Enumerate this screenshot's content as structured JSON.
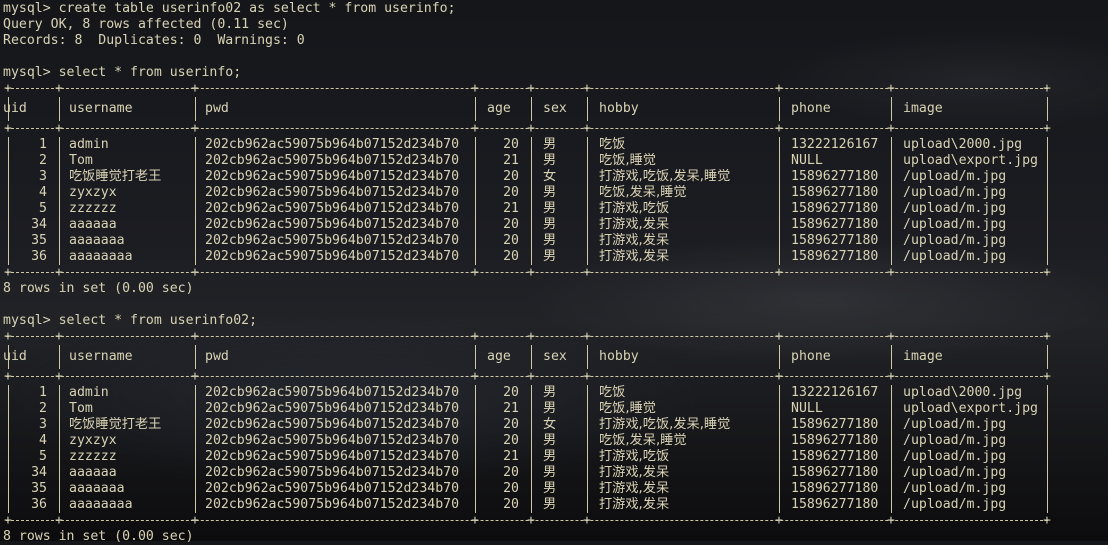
{
  "lines": {
    "cmd1": "mysql> create table userinfo02 as select * from userinfo;",
    "ok1": "Query OK, 8 rows affected (0.11 sec)",
    "rec1": "Records: 8  Duplicates: 0  Warnings: 0",
    "cmd2": "mysql> select * from userinfo;",
    "res2": "8 rows in set (0.00 sec)",
    "cmd3": "mysql> select * from userinfo02;",
    "res3": "8 rows in set (0.00 sec)"
  },
  "columns": [
    "uid",
    "username",
    "pwd",
    "age",
    "sex",
    "hobby",
    "phone",
    "image"
  ],
  "table1": [
    [
      "1",
      "admin",
      "202cb962ac59075b964b07152d234b70",
      "20",
      "男",
      "吃饭",
      "13222126167",
      "upload\\2000.jpg"
    ],
    [
      "2",
      "Tom",
      "202cb962ac59075b964b07152d234b70",
      "21",
      "男",
      "吃饭,睡觉",
      "NULL",
      "upload\\export.jpg"
    ],
    [
      "3",
      "吃饭睡觉打老王",
      "202cb962ac59075b964b07152d234b70",
      "20",
      "女",
      "打游戏,吃饭,发呆,睡觉",
      "15896277180",
      "/upload/m.jpg"
    ],
    [
      "4",
      "zyxzyx",
      "202cb962ac59075b964b07152d234b70",
      "20",
      "男",
      "吃饭,发呆,睡觉",
      "15896277180",
      "/upload/m.jpg"
    ],
    [
      "5",
      "zzzzzz",
      "202cb962ac59075b964b07152d234b70",
      "21",
      "男",
      "打游戏,吃饭",
      "15896277180",
      "/upload/m.jpg"
    ],
    [
      "34",
      "aaaaaa",
      "202cb962ac59075b964b07152d234b70",
      "20",
      "男",
      "打游戏,发呆",
      "15896277180",
      "/upload/m.jpg"
    ],
    [
      "35",
      "aaaaaaa",
      "202cb962ac59075b964b07152d234b70",
      "20",
      "男",
      "打游戏,发呆",
      "15896277180",
      "/upload/m.jpg"
    ],
    [
      "36",
      "aaaaaaaa",
      "202cb962ac59075b964b07152d234b70",
      "20",
      "男",
      "打游戏,发呆",
      "15896277180",
      "/upload/m.jpg"
    ]
  ],
  "table2": [
    [
      "1",
      "admin",
      "202cb962ac59075b964b07152d234b70",
      "20",
      "男",
      "吃饭",
      "13222126167",
      "upload\\2000.jpg"
    ],
    [
      "2",
      "Tom",
      "202cb962ac59075b964b07152d234b70",
      "21",
      "男",
      "吃饭,睡觉",
      "NULL",
      "upload\\export.jpg"
    ],
    [
      "3",
      "吃饭睡觉打老王",
      "202cb962ac59075b964b07152d234b70",
      "20",
      "女",
      "打游戏,吃饭,发呆,睡觉",
      "15896277180",
      "/upload/m.jpg"
    ],
    [
      "4",
      "zyxzyx",
      "202cb962ac59075b964b07152d234b70",
      "20",
      "男",
      "吃饭,发呆,睡觉",
      "15896277180",
      "/upload/m.jpg"
    ],
    [
      "5",
      "zzzzzz",
      "202cb962ac59075b964b07152d234b70",
      "21",
      "男",
      "打游戏,吃饭",
      "15896277180",
      "/upload/m.jpg"
    ],
    [
      "34",
      "aaaaaa",
      "202cb962ac59075b964b07152d234b70",
      "20",
      "男",
      "打游戏,发呆",
      "15896277180",
      "/upload/m.jpg"
    ],
    [
      "35",
      "aaaaaaa",
      "202cb962ac59075b964b07152d234b70",
      "20",
      "男",
      "打游戏,发呆",
      "15896277180",
      "/upload/m.jpg"
    ],
    [
      "36",
      "aaaaaaaa",
      "202cb962ac59075b964b07152d234b70",
      "20",
      "男",
      "打游戏,发呆",
      "15896277180",
      "/upload/m.jpg"
    ]
  ],
  "colors": {
    "text": "#d9d3b4",
    "background": "#1c1d22"
  }
}
